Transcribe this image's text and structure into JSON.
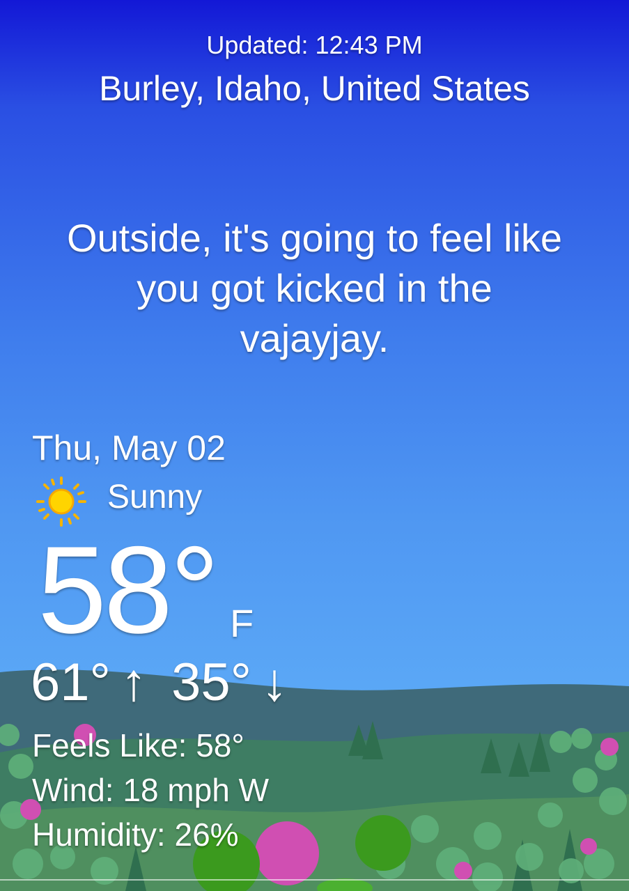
{
  "header": {
    "updated": "Updated: 12:43 PM",
    "location": "Burley, Idaho, United States"
  },
  "message": "Outside, it's going to feel like you got kicked in the vajayjay.",
  "today": {
    "date": "Thu, May 02",
    "condition_icon": "sun-icon",
    "condition": "Sunny",
    "temperature": "58°",
    "unit": "F",
    "high": "61°",
    "high_arrow": "↑",
    "low": "35°",
    "low_arrow": "↓"
  },
  "details": {
    "feels_like": "Feels Like: 58°",
    "wind": "Wind: 18 mph W",
    "humidity": "Humidity: 26%"
  },
  "colors": {
    "sky_top": "#1318d6",
    "sky_bottom": "#63b1f7",
    "hills": "#3f6f78",
    "trees_green": "#3aa63a",
    "trees_pink": "#d94fb6"
  }
}
